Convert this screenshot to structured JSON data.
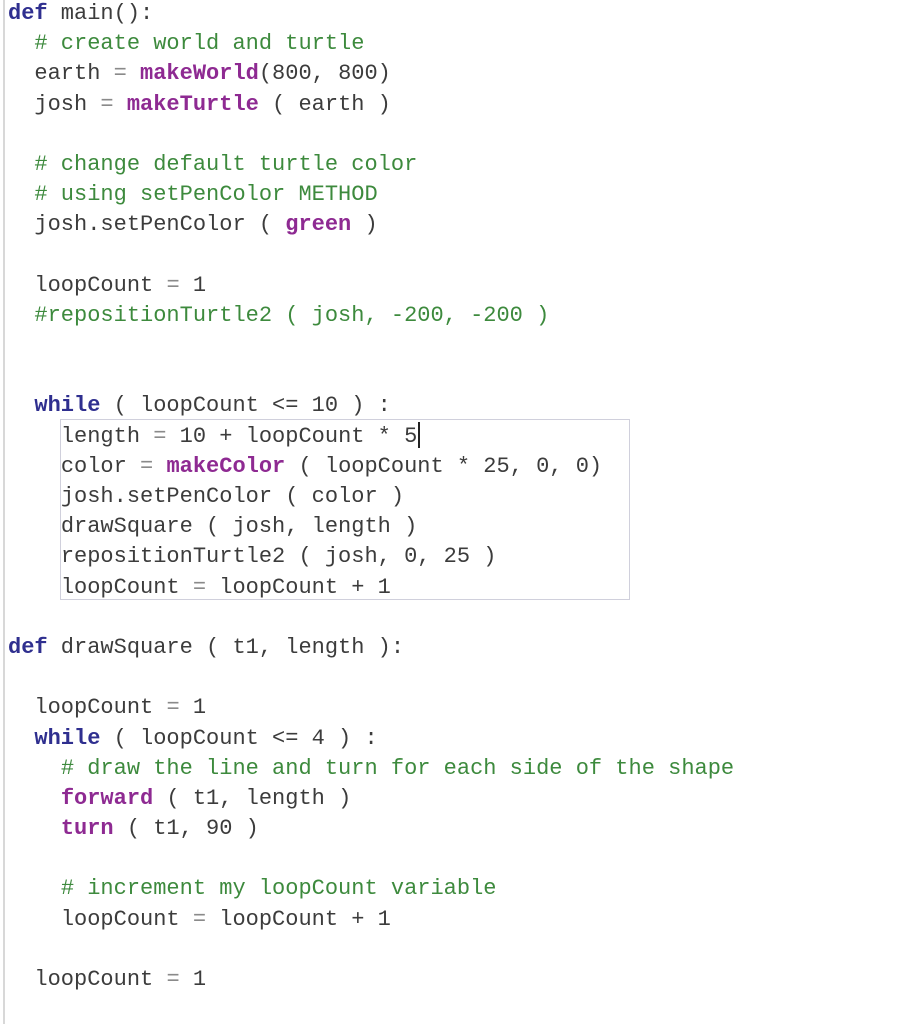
{
  "editor": {
    "lines": [
      {
        "indent": 0,
        "tokens": [
          {
            "t": "kw",
            "v": "def"
          },
          {
            "t": "tx",
            "v": " main():"
          }
        ]
      },
      {
        "indent": 2,
        "tokens": [
          {
            "t": "cm",
            "v": "# create world and turtle"
          }
        ]
      },
      {
        "indent": 2,
        "tokens": [
          {
            "t": "tx",
            "v": "earth "
          },
          {
            "t": "op",
            "v": "="
          },
          {
            "t": "tx",
            "v": " "
          },
          {
            "t": "fn",
            "v": "makeWorld"
          },
          {
            "t": "tx",
            "v": "(800, 800)"
          }
        ]
      },
      {
        "indent": 2,
        "tokens": [
          {
            "t": "tx",
            "v": "josh "
          },
          {
            "t": "op",
            "v": "="
          },
          {
            "t": "tx",
            "v": " "
          },
          {
            "t": "fn",
            "v": "makeTurtle"
          },
          {
            "t": "tx",
            "v": " ( earth )"
          }
        ]
      },
      {
        "indent": 0,
        "tokens": []
      },
      {
        "indent": 2,
        "tokens": [
          {
            "t": "cm",
            "v": "# change default turtle color"
          }
        ]
      },
      {
        "indent": 2,
        "tokens": [
          {
            "t": "cm",
            "v": "# using setPenColor METHOD"
          }
        ]
      },
      {
        "indent": 2,
        "tokens": [
          {
            "t": "tx",
            "v": "josh.setPenColor ( "
          },
          {
            "t": "fn",
            "v": "green"
          },
          {
            "t": "tx",
            "v": " )"
          }
        ]
      },
      {
        "indent": 0,
        "tokens": []
      },
      {
        "indent": 2,
        "tokens": [
          {
            "t": "tx",
            "v": "loopCount "
          },
          {
            "t": "op",
            "v": "="
          },
          {
            "t": "tx",
            "v": " 1"
          }
        ]
      },
      {
        "indent": 2,
        "tokens": [
          {
            "t": "cm",
            "v": "#repositionTurtle2 ( josh, -200, -200 )"
          }
        ]
      },
      {
        "indent": 0,
        "tokens": []
      },
      {
        "indent": 0,
        "tokens": []
      },
      {
        "indent": 2,
        "tokens": [
          {
            "t": "kw",
            "v": "while"
          },
          {
            "t": "tx",
            "v": " ( loopCount <= 10 ) :"
          }
        ]
      },
      {
        "indent": 4,
        "tokens": [
          {
            "t": "tx",
            "v": "length "
          },
          {
            "t": "op",
            "v": "="
          },
          {
            "t": "tx",
            "v": " 10 + loopCount * 5"
          }
        ],
        "caret": true
      },
      {
        "indent": 4,
        "tokens": [
          {
            "t": "tx",
            "v": "color "
          },
          {
            "t": "op",
            "v": "="
          },
          {
            "t": "tx",
            "v": " "
          },
          {
            "t": "fn",
            "v": "makeColor"
          },
          {
            "t": "tx",
            "v": " ( loopCount * 25, 0, 0)"
          }
        ]
      },
      {
        "indent": 4,
        "tokens": [
          {
            "t": "tx",
            "v": "josh.setPenColor ( color )"
          }
        ]
      },
      {
        "indent": 4,
        "tokens": [
          {
            "t": "tx",
            "v": "drawSquare ( josh, length )"
          }
        ]
      },
      {
        "indent": 4,
        "tokens": [
          {
            "t": "tx",
            "v": "repositionTurtle2 ( josh, 0, 25 )"
          }
        ]
      },
      {
        "indent": 4,
        "tokens": [
          {
            "t": "tx",
            "v": "loopCount "
          },
          {
            "t": "op",
            "v": "="
          },
          {
            "t": "tx",
            "v": " loopCount + 1"
          }
        ]
      },
      {
        "indent": 0,
        "tokens": []
      },
      {
        "indent": 0,
        "tokens": [
          {
            "t": "kw",
            "v": "def"
          },
          {
            "t": "tx",
            "v": " drawSquare ( t1, length ):"
          }
        ]
      },
      {
        "indent": 0,
        "tokens": []
      },
      {
        "indent": 2,
        "tokens": [
          {
            "t": "tx",
            "v": "loopCount "
          },
          {
            "t": "op",
            "v": "="
          },
          {
            "t": "tx",
            "v": " 1"
          }
        ]
      },
      {
        "indent": 2,
        "tokens": [
          {
            "t": "kw",
            "v": "while"
          },
          {
            "t": "tx",
            "v": " ( loopCount <= 4 ) :"
          }
        ]
      },
      {
        "indent": 4,
        "tokens": [
          {
            "t": "cm",
            "v": "# draw the line and turn for each side of the shape"
          }
        ]
      },
      {
        "indent": 4,
        "tokens": [
          {
            "t": "fn",
            "v": "forward"
          },
          {
            "t": "tx",
            "v": " ( t1, length )"
          }
        ]
      },
      {
        "indent": 4,
        "tokens": [
          {
            "t": "fn",
            "v": "turn"
          },
          {
            "t": "tx",
            "v": " ( t1, 90 )"
          }
        ]
      },
      {
        "indent": 0,
        "tokens": []
      },
      {
        "indent": 4,
        "tokens": [
          {
            "t": "cm",
            "v": "# increment my loopCount variable"
          }
        ]
      },
      {
        "indent": 4,
        "tokens": [
          {
            "t": "tx",
            "v": "loopCount "
          },
          {
            "t": "op",
            "v": "="
          },
          {
            "t": "tx",
            "v": " loopCount + 1"
          }
        ]
      },
      {
        "indent": 0,
        "tokens": []
      },
      {
        "indent": 2,
        "tokens": [
          {
            "t": "tx",
            "v": "loopCount "
          },
          {
            "t": "op",
            "v": "="
          },
          {
            "t": "tx",
            "v": " 1"
          }
        ]
      }
    ]
  },
  "colors": {
    "keyword": "#2f2f8f",
    "function": "#8e2a92",
    "comment": "#3d8a3d",
    "text": "#3c3c3c"
  }
}
